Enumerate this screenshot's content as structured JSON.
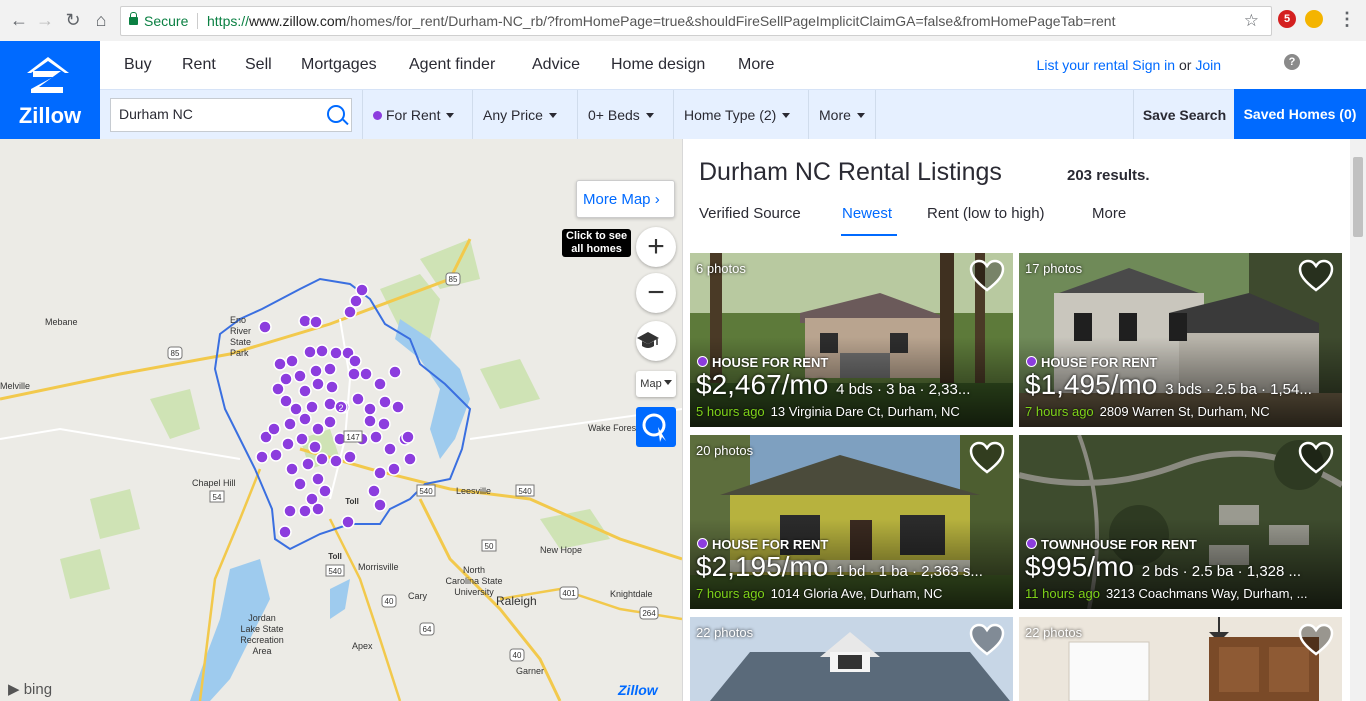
{
  "browser": {
    "secure_label": "Secure",
    "url_scheme": "https://",
    "url_host": "www.zillow.com",
    "url_path": "/homes/for_rent/Durham-NC_rb/?fromHomePage=true&shouldFireSellPageImplicitClaimGA=false&fromHomePageTab=rent",
    "extension_badge": "5"
  },
  "logo": {
    "word": "Zillow"
  },
  "nav": {
    "items": [
      "Buy",
      "Rent",
      "Sell",
      "Mortgages",
      "Agent finder",
      "Advice",
      "Home design",
      "More"
    ],
    "list_rental": "List your rental",
    "sign_in": "Sign in",
    "or": "or",
    "join": "Join",
    "help": "?"
  },
  "filters": {
    "search_value": "Durham NC",
    "for_rent": "For Rent",
    "price": "Any Price",
    "beds": "0+ Beds",
    "home_type": "Home Type (2)",
    "more": "More",
    "save_search": "Save Search",
    "saved_homes": "Saved Homes (0)"
  },
  "map": {
    "more_map": "More Map",
    "tooltip_line1": "Click to see",
    "tooltip_line2": "all homes",
    "zoom_in": "+",
    "zoom_out": "−",
    "map_type": "Map",
    "attribution": "bing",
    "watermark": "Zillow",
    "places": [
      "Mebane",
      "Eno River State Park",
      "Melville",
      "Chapel Hill",
      "Leesville",
      "Wake Forest",
      "New Hope",
      "Morrisville",
      "North Carolina State University",
      "Raleigh",
      "Cary",
      "Knightdale",
      "Jordan Lake State Recreation Area",
      "Apex",
      "Garner"
    ],
    "road_shields": [
      "85",
      "85",
      "54",
      "540",
      "540",
      "50",
      "40",
      "540",
      "64",
      "40",
      "264",
      "401",
      "147",
      "Toll",
      "Toll"
    ],
    "cluster_label": "2"
  },
  "listings": {
    "title": "Durham NC Rental Listings",
    "results": "203 results.",
    "sort_tabs": [
      "Verified Source",
      "Newest",
      "Rent (low to high)",
      "More"
    ],
    "active_sort": "Newest",
    "cards": [
      {
        "photos": "6 photos",
        "type": "HOUSE FOR RENT",
        "price": "$2,467/mo",
        "facts": "4 bds · 3 ba · 2,33...",
        "ago": "5 hours ago",
        "address": "13 Virginia Dare Ct, Durham, NC"
      },
      {
        "photos": "17 photos",
        "type": "HOUSE FOR RENT",
        "price": "$1,495/mo",
        "facts": "3 bds · 2.5 ba · 1,54...",
        "ago": "7 hours ago",
        "address": "2809 Warren St, Durham, NC"
      },
      {
        "photos": "20 photos",
        "type": "HOUSE FOR RENT",
        "price": "$2,195/mo",
        "facts": "1 bd · 1 ba · 2,363 s...",
        "ago": "7 hours ago",
        "address": "1014 Gloria Ave, Durham, NC"
      },
      {
        "photos": "",
        "type": "TOWNHOUSE FOR RENT",
        "price": "$995/mo",
        "facts": "2 bds · 2.5 ba · 1,328 ...",
        "ago": "11 hours ago",
        "address": "3213 Coachmans Way, Durham, ..."
      },
      {
        "photos": "22 photos",
        "type": "",
        "price": "",
        "facts": "",
        "ago": "",
        "address": ""
      },
      {
        "photos": "22 photos",
        "type": "",
        "price": "",
        "facts": "",
        "ago": "",
        "address": ""
      }
    ]
  },
  "colors": {
    "brand": "#006aff",
    "pin": "#8c3dde",
    "boundary": "#3a6fe0",
    "recency": "#7fd31a"
  }
}
